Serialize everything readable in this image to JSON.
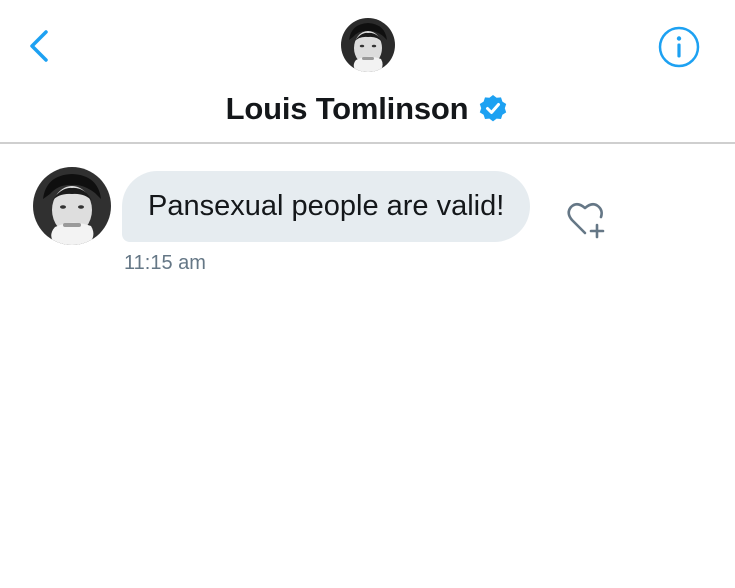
{
  "header": {
    "title": "Louis Tomlinson",
    "back_icon": "chevron-left-icon",
    "info_icon": "info-icon",
    "verified_icon": "verified-badge-icon",
    "accent_color": "#1da1f2"
  },
  "conversation": {
    "messages": [
      {
        "text": "Pansexual people are valid!",
        "time": "11:15 am",
        "bubble_color": "#e6ecf0",
        "reaction_icon": "add-reaction-heart-icon"
      }
    ]
  }
}
